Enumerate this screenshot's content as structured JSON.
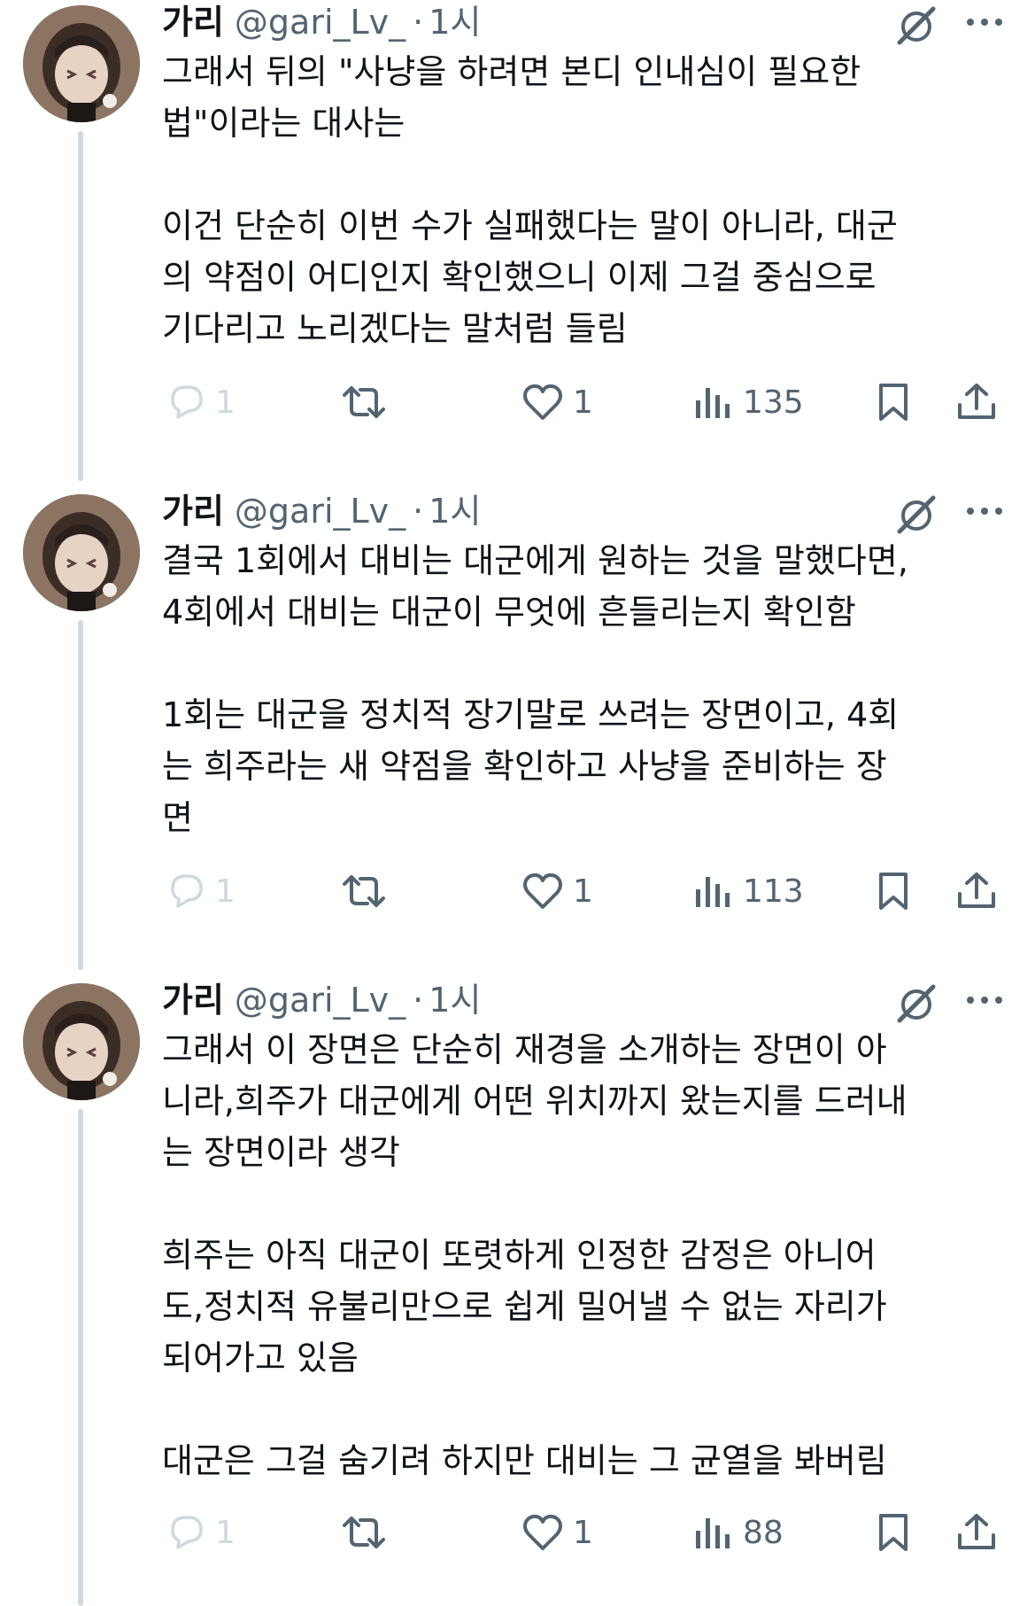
{
  "tweets": [
    {
      "author": {
        "name": "가리",
        "handle": "@gari_Lv_",
        "dot": "·",
        "time": "1시"
      },
      "paragraphs": [
        [
          "그래서 뒤의 \"사냥을 하려면 본디 인내심이 필요한",
          "법\"이라는 대사는"
        ],
        [
          "이건 단순히 이번 수가 실패했다는 말이 아니라, 대군",
          "의 약점이 어디인지 확인했으니 이제 그걸 중심으로",
          "기다리고 노리겠다는 말처럼 들림"
        ]
      ],
      "stats": {
        "replies": "1",
        "likes": "1",
        "views": "135"
      }
    },
    {
      "author": {
        "name": "가리",
        "handle": "@gari_Lv_",
        "dot": "·",
        "time": "1시"
      },
      "paragraphs": [
        [
          "결국 1회에서 대비는 대군에게 원하는 것을 말했다면,",
          "4회에서 대비는 대군이 무엇에 흔들리는지 확인함"
        ],
        [
          "1회는 대군을 정치적 장기말로 쓰려는 장면이고, 4회",
          "는 희주라는 새 약점을 확인하고 사냥을 준비하는 장",
          "면"
        ]
      ],
      "stats": {
        "replies": "1",
        "likes": "1",
        "views": "113"
      }
    },
    {
      "author": {
        "name": "가리",
        "handle": "@gari_Lv_",
        "dot": "·",
        "time": "1시"
      },
      "paragraphs": [
        [
          "그래서 이 장면은 단순히 재경을 소개하는 장면이 아",
          "니라,희주가 대군에게 어떤 위치까지 왔는지를 드러내",
          "는 장면이라 생각"
        ],
        [
          "희주는 아직 대군이 또렷하게 인정한 감정은 아니어",
          "도,정치적 유불리만으로 쉽게 밀어낼 수 없는 자리가",
          "되어가고 있음"
        ],
        [
          "대군은 그걸 숨기려 하지만 대비는 그 균열을 봐버림"
        ]
      ],
      "stats": {
        "replies": "1",
        "likes": "1",
        "views": "88"
      }
    }
  ],
  "icons": {
    "reply": "reply-icon",
    "retweet": "retweet-icon",
    "like": "heart-icon",
    "views": "views-icon",
    "bookmark": "bookmark-icon",
    "share": "share-icon",
    "grok": "grok-icon",
    "more": "more-icon"
  },
  "colors": {
    "text": "#0f1419",
    "secondary": "#536471",
    "thread_line": "#cfd9de",
    "faded_reply": "#cfd9de"
  }
}
